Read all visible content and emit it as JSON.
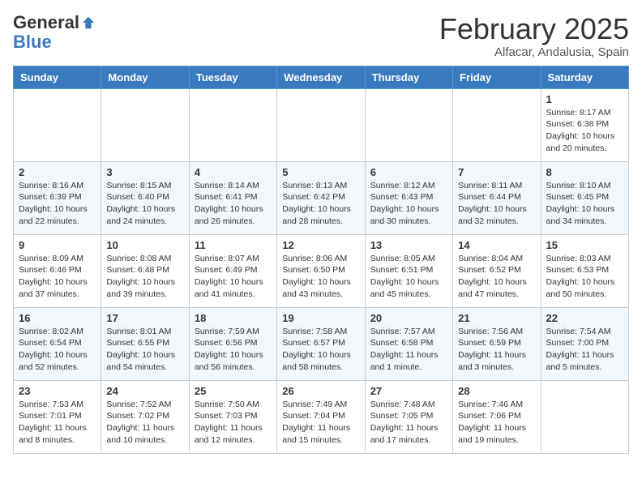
{
  "header": {
    "logo_general": "General",
    "logo_blue": "Blue",
    "month_title": "February 2025",
    "location": "Alfacar, Andalusia, Spain"
  },
  "days_of_week": [
    "Sunday",
    "Monday",
    "Tuesday",
    "Wednesday",
    "Thursday",
    "Friday",
    "Saturday"
  ],
  "weeks": [
    [
      {
        "day": "",
        "info": ""
      },
      {
        "day": "",
        "info": ""
      },
      {
        "day": "",
        "info": ""
      },
      {
        "day": "",
        "info": ""
      },
      {
        "day": "",
        "info": ""
      },
      {
        "day": "",
        "info": ""
      },
      {
        "day": "1",
        "info": "Sunrise: 8:17 AM\nSunset: 6:38 PM\nDaylight: 10 hours and 20 minutes."
      }
    ],
    [
      {
        "day": "2",
        "info": "Sunrise: 8:16 AM\nSunset: 6:39 PM\nDaylight: 10 hours and 22 minutes."
      },
      {
        "day": "3",
        "info": "Sunrise: 8:15 AM\nSunset: 6:40 PM\nDaylight: 10 hours and 24 minutes."
      },
      {
        "day": "4",
        "info": "Sunrise: 8:14 AM\nSunset: 6:41 PM\nDaylight: 10 hours and 26 minutes."
      },
      {
        "day": "5",
        "info": "Sunrise: 8:13 AM\nSunset: 6:42 PM\nDaylight: 10 hours and 28 minutes."
      },
      {
        "day": "6",
        "info": "Sunrise: 8:12 AM\nSunset: 6:43 PM\nDaylight: 10 hours and 30 minutes."
      },
      {
        "day": "7",
        "info": "Sunrise: 8:11 AM\nSunset: 6:44 PM\nDaylight: 10 hours and 32 minutes."
      },
      {
        "day": "8",
        "info": "Sunrise: 8:10 AM\nSunset: 6:45 PM\nDaylight: 10 hours and 34 minutes."
      }
    ],
    [
      {
        "day": "9",
        "info": "Sunrise: 8:09 AM\nSunset: 6:46 PM\nDaylight: 10 hours and 37 minutes."
      },
      {
        "day": "10",
        "info": "Sunrise: 8:08 AM\nSunset: 6:48 PM\nDaylight: 10 hours and 39 minutes."
      },
      {
        "day": "11",
        "info": "Sunrise: 8:07 AM\nSunset: 6:49 PM\nDaylight: 10 hours and 41 minutes."
      },
      {
        "day": "12",
        "info": "Sunrise: 8:06 AM\nSunset: 6:50 PM\nDaylight: 10 hours and 43 minutes."
      },
      {
        "day": "13",
        "info": "Sunrise: 8:05 AM\nSunset: 6:51 PM\nDaylight: 10 hours and 45 minutes."
      },
      {
        "day": "14",
        "info": "Sunrise: 8:04 AM\nSunset: 6:52 PM\nDaylight: 10 hours and 47 minutes."
      },
      {
        "day": "15",
        "info": "Sunrise: 8:03 AM\nSunset: 6:53 PM\nDaylight: 10 hours and 50 minutes."
      }
    ],
    [
      {
        "day": "16",
        "info": "Sunrise: 8:02 AM\nSunset: 6:54 PM\nDaylight: 10 hours and 52 minutes."
      },
      {
        "day": "17",
        "info": "Sunrise: 8:01 AM\nSunset: 6:55 PM\nDaylight: 10 hours and 54 minutes."
      },
      {
        "day": "18",
        "info": "Sunrise: 7:59 AM\nSunset: 6:56 PM\nDaylight: 10 hours and 56 minutes."
      },
      {
        "day": "19",
        "info": "Sunrise: 7:58 AM\nSunset: 6:57 PM\nDaylight: 10 hours and 58 minutes."
      },
      {
        "day": "20",
        "info": "Sunrise: 7:57 AM\nSunset: 6:58 PM\nDaylight: 11 hours and 1 minute."
      },
      {
        "day": "21",
        "info": "Sunrise: 7:56 AM\nSunset: 6:59 PM\nDaylight: 11 hours and 3 minutes."
      },
      {
        "day": "22",
        "info": "Sunrise: 7:54 AM\nSunset: 7:00 PM\nDaylight: 11 hours and 5 minutes."
      }
    ],
    [
      {
        "day": "23",
        "info": "Sunrise: 7:53 AM\nSunset: 7:01 PM\nDaylight: 11 hours and 8 minutes."
      },
      {
        "day": "24",
        "info": "Sunrise: 7:52 AM\nSunset: 7:02 PM\nDaylight: 11 hours and 10 minutes."
      },
      {
        "day": "25",
        "info": "Sunrise: 7:50 AM\nSunset: 7:03 PM\nDaylight: 11 hours and 12 minutes."
      },
      {
        "day": "26",
        "info": "Sunrise: 7:49 AM\nSunset: 7:04 PM\nDaylight: 11 hours and 15 minutes."
      },
      {
        "day": "27",
        "info": "Sunrise: 7:48 AM\nSunset: 7:05 PM\nDaylight: 11 hours and 17 minutes."
      },
      {
        "day": "28",
        "info": "Sunrise: 7:46 AM\nSunset: 7:06 PM\nDaylight: 11 hours and 19 minutes."
      },
      {
        "day": "",
        "info": ""
      }
    ]
  ]
}
